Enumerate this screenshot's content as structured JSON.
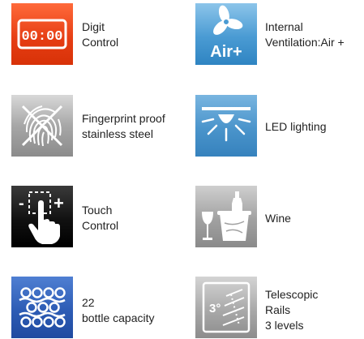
{
  "features": [
    {
      "id": "digit-control",
      "icon": "digital-display-icon",
      "lines": [
        "Digit",
        "Control"
      ],
      "glyph": "00:00",
      "color": "#e53c12"
    },
    {
      "id": "internal-ventilation",
      "icon": "fan-icon",
      "lines": [
        "Internal",
        "Ventilation:Air +"
      ],
      "glyph": "Air+",
      "color": "#4a9bd3"
    },
    {
      "id": "fingerprint-proof",
      "icon": "fingerprint-crossed-icon",
      "lines": [
        "Fingerprint proof",
        "stainless steel"
      ],
      "color": "#a7a7a7"
    },
    {
      "id": "led-lighting",
      "icon": "led-light-icon",
      "lines": [
        "LED lighting"
      ],
      "color": "#4a94cb"
    },
    {
      "id": "touch-control",
      "icon": "touch-hand-icon",
      "lines": [
        "Touch",
        "Control"
      ],
      "glyph_minus": "-",
      "glyph_plus": "+",
      "color": "#111111"
    },
    {
      "id": "wine",
      "icon": "wine-bucket-icon",
      "lines": [
        "Wine"
      ],
      "color": "#a1a1a1"
    },
    {
      "id": "bottle-capacity",
      "icon": "bottle-rack-icon",
      "lines": [
        "22",
        "bottle capacity"
      ],
      "color": "#2d5cb5"
    },
    {
      "id": "telescopic-rails",
      "icon": "telescopic-rails-icon",
      "lines": [
        "Telescopic",
        "Rails",
        "3 levels"
      ],
      "glyph": "3°",
      "color": "#a9a9a9"
    }
  ]
}
